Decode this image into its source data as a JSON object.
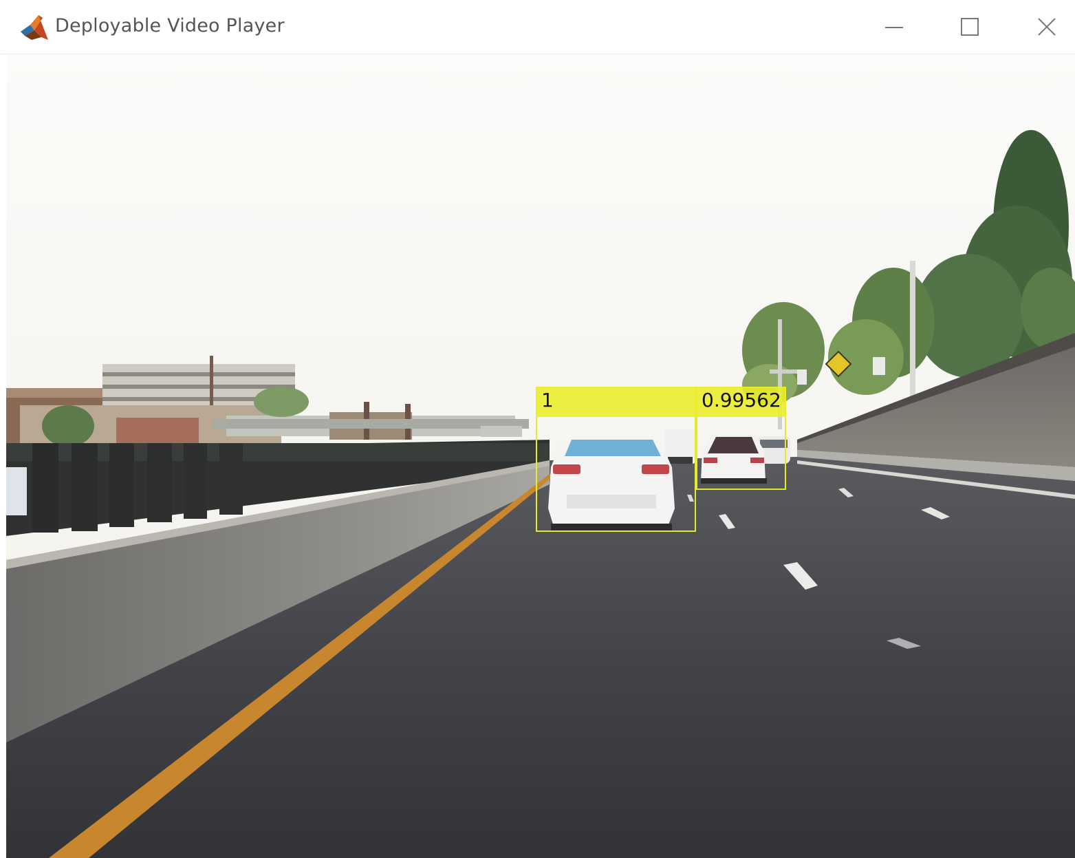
{
  "window": {
    "title": "Deployable Video Player",
    "app_icon": "matlab-logo-icon",
    "controls": {
      "minimize_icon": "minimize-icon",
      "maximize_icon": "maximize-icon",
      "close_icon": "close-icon"
    }
  },
  "video": {
    "detections": [
      {
        "label": "1"
      },
      {
        "label": "0.99562"
      }
    ],
    "colors": {
      "bbox": "#e7ea2c",
      "sky": "#f6f5f2",
      "road": "#3f3f43",
      "lane_line": "#c8872e"
    }
  }
}
